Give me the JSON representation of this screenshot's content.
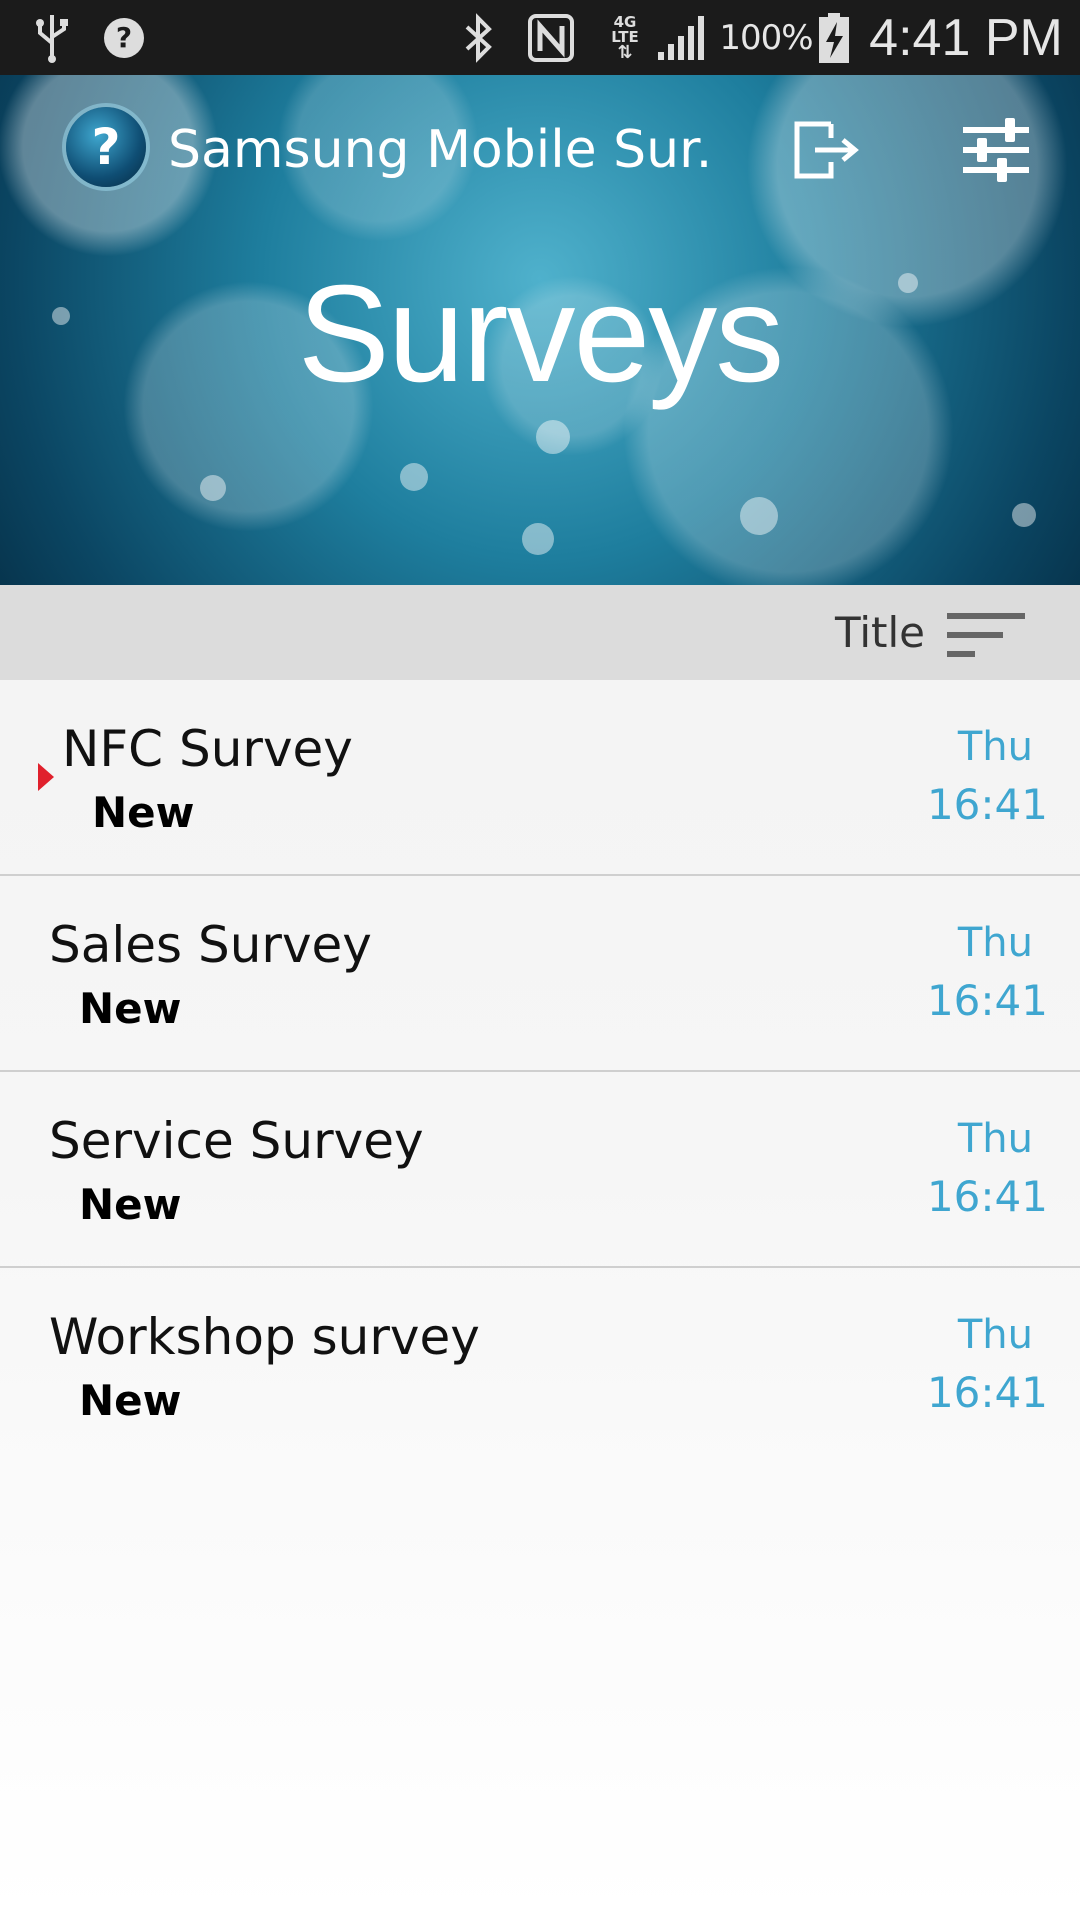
{
  "status_bar": {
    "battery_percent": "100%",
    "clock": "4:41 PM",
    "network_label": "4G LTE",
    "icons": [
      "usb-icon",
      "help-icon",
      "bluetooth-icon",
      "nfc-icon",
      "4g-lte-icon",
      "signal-icon",
      "battery-charging-icon"
    ]
  },
  "header": {
    "app_title": "Samsung Mobile Sur...",
    "page_title": "Surveys",
    "logo_glyph": "?",
    "actions": [
      "logout-icon",
      "settings-sliders-icon"
    ]
  },
  "sort": {
    "label": "Title",
    "icon": "sort-icon"
  },
  "surveys": [
    {
      "title": "NFC Survey",
      "status": "New",
      "day": "Thu",
      "time": "16:41",
      "unread": true
    },
    {
      "title": "Sales Survey",
      "status": "New",
      "day": "Thu",
      "time": "16:41",
      "unread": false
    },
    {
      "title": "Service Survey",
      "status": "New",
      "day": "Thu",
      "time": "16:41",
      "unread": false
    },
    {
      "title": "Workshop survey",
      "status": "New",
      "day": "Thu",
      "time": "16:41",
      "unread": false
    }
  ],
  "colors": {
    "accent_blue": "#3fa6d0",
    "unread_marker": "#e0202c",
    "status_bar_bg": "#1b1b1b"
  }
}
